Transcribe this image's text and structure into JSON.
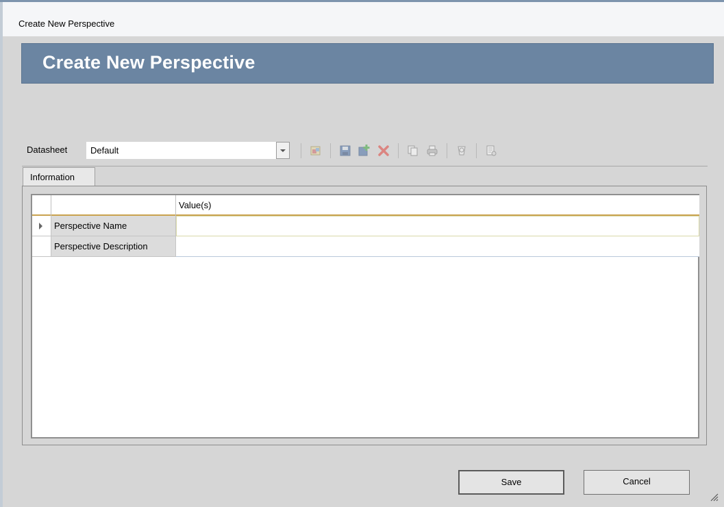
{
  "window": {
    "title": "Create New Perspective"
  },
  "banner": {
    "title": "Create New Perspective"
  },
  "toolbar": {
    "datasheet_label": "Datasheet",
    "datasheet_value": "Default",
    "icons": [
      "new-record-icon",
      "save-icon",
      "add-icon",
      "delete-icon",
      "copy-icon",
      "print-icon",
      "query-icon",
      "reference-icon"
    ]
  },
  "tabs": [
    {
      "label": "Information"
    }
  ],
  "grid": {
    "header": {
      "value_label": "Value(s)"
    },
    "rows": [
      {
        "name": "Perspective Name",
        "value": ""
      },
      {
        "name": "Perspective Description",
        "value": ""
      }
    ]
  },
  "buttons": {
    "save": "Save",
    "cancel": "Cancel"
  },
  "colors": {
    "banner": "#6b85a2",
    "header_underline": "#c9a24e",
    "delete_red": "#e0443c"
  }
}
